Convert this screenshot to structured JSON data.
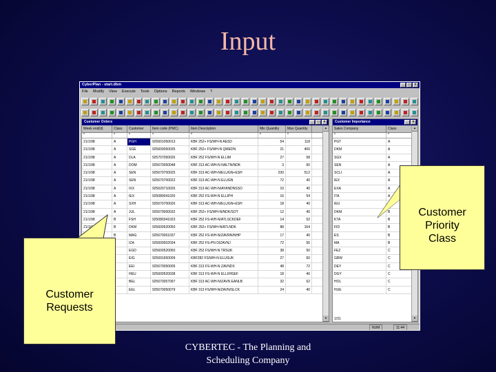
{
  "slide": {
    "title": "Input",
    "footer_line1": "CYBERTEC - The Planning and",
    "footer_line2": "Scheduling Company"
  },
  "app": {
    "title": "CyberPlan - start.dbm",
    "menu": [
      "File",
      "Modify",
      "View",
      "Execute",
      "Tools",
      "Options",
      "Reports",
      "Windows",
      "?"
    ],
    "status_left": "NUM",
    "status_right": "11:44"
  },
  "orders_window": {
    "title": "Customer Orders",
    "columns": [
      "Week end(d)",
      "Class",
      "Customer",
      "Item code (PMC)",
      "Item Description",
      "Min Quantity",
      "Max Quantity"
    ],
    "filter_marks": [
      "*",
      "*",
      "*",
      "*",
      "*",
      "*",
      "*"
    ],
    "rows": [
      [
        "21/1/98",
        "A",
        "PGH",
        "925601050013",
        "KBF 252+ FS/WH-N AESD",
        "54",
        "118"
      ],
      [
        "21/1/98",
        "A",
        "SGE",
        "925600050035",
        "KBF 252+ FS/WH-N QMEDN",
        "21",
        "400"
      ],
      [
        "21/1/98",
        "A",
        "DLA",
        "925707050026",
        "KBF 252 FS/WH-N ELLIM",
        "27",
        "58"
      ],
      [
        "21/1/98",
        "A",
        "DOM",
        "925670050048",
        "KBF 313 AC-WH-N NALTN/NDK",
        "3",
        "60"
      ],
      [
        "21/1/98",
        "A",
        "SEN",
        "925670700025",
        "KBF 313 AC-WH-N/ELUGN+ESH",
        "230",
        "512"
      ],
      [
        "21/1/98",
        "A",
        "SEN",
        "925670700022",
        "KBF 313 AC-WH-N ELUGN",
        "72",
        "40"
      ],
      [
        "21/1/98",
        "A",
        "IXX",
        "925620710026",
        "KBF 313 AC-WH-N/AYANDNSSO",
        "10",
        "40"
      ],
      [
        "21/1/98",
        "A",
        "IEX",
        "925080041026",
        "KBF 252 FS-WH-N ELLIPH",
        "16",
        "54"
      ],
      [
        "21/1/98",
        "A",
        "SXH",
        "925670700026",
        "KBF 313 AC-WH-N/ELUGN+ESH",
        "18",
        "40"
      ],
      [
        "21/1/98",
        "A",
        "JUL",
        "925670000032",
        "KBF 252+ FS/WH-N/NDK/SOT",
        "12",
        "40"
      ],
      [
        "21/1/98",
        "B",
        "FSH",
        "925080341023",
        "KBF 252 FS-WH-N/ATLSCKDEF",
        "14",
        "52"
      ],
      [
        "21/1/98",
        "B",
        "DKM",
        "925600520050",
        "KBF 252+ FS/WH-N/ATLNDK",
        "88",
        "164"
      ],
      [
        "21/1/98",
        "B",
        "MAG",
        "925670061037",
        "KBF 252 FS-WH-N/ZAVRN/NHP",
        "17",
        "40"
      ],
      [
        "21/1/98",
        "B",
        "IZA",
        "925600502034",
        "KBF 252 FS-PN DIZAVNJ",
        "72",
        "56"
      ],
      [
        "21/1/98",
        "B",
        "EGD",
        "925600520050",
        "KBF 252 FS/WH-N TRSUK",
        "38",
        "50"
      ],
      [
        "21/1/98",
        "B",
        "EIG",
        "925691650009",
        "KBF282 FS/WH-N ELUSUK",
        "27",
        "60"
      ],
      [
        "21/1/98",
        "B",
        "EEI",
        "925670050005",
        "KBF 313 FS-WH-N ZAVNDX",
        "48",
        "72"
      ],
      [
        "21/1/98",
        "B",
        "HEU",
        "925600520038",
        "KBF 313 FS-WH-N ELLIIHSEF",
        "18",
        "40"
      ],
      [
        "21/1/98",
        "C",
        "BEL",
        "925670057097",
        "KBF 313 AC-WH-N/ZAVN EANLB",
        "32",
        "62"
      ],
      [
        "21/1/98",
        "C",
        "EEL",
        "925670050079",
        "KBF 313 FS/WH-N/ZAVN/SLCK",
        "24",
        "40"
      ]
    ]
  },
  "priority_window": {
    "title": "Customer Importance",
    "columns": [
      "Sales Company",
      "Class"
    ],
    "filter_marks": [
      "*",
      "*"
    ],
    "rows": [
      [
        "PGT",
        "A"
      ],
      [
        "DKM",
        "A"
      ],
      [
        "SGX",
        "A"
      ],
      [
        "SEN",
        "A"
      ],
      [
        "SCLI",
        "A"
      ],
      [
        "IEX",
        "A"
      ],
      [
        "EXA",
        "A"
      ],
      [
        "ITA",
        "A"
      ],
      [
        "IEU",
        "B"
      ],
      [
        "DKM",
        "B"
      ],
      [
        "KTA",
        "B"
      ],
      [
        "FID",
        "B"
      ],
      [
        "ES",
        "B"
      ],
      [
        "MA",
        "B"
      ],
      [
        "FEZ",
        "C"
      ],
      [
        "GBW",
        "C"
      ],
      [
        "DEY",
        "C"
      ],
      [
        "DGY",
        "C"
      ],
      [
        "HOL",
        "C"
      ],
      [
        "HUE",
        "C"
      ]
    ],
    "record_indicator": "1/31"
  },
  "callouts": {
    "priority_line1": "Customer",
    "priority_line2": "Priority",
    "priority_line3": "Class",
    "requests_line1": "Customer",
    "requests_line2": "Requests"
  }
}
